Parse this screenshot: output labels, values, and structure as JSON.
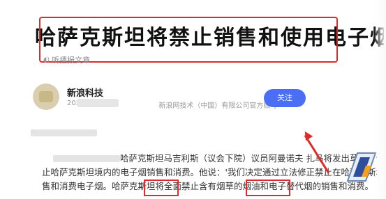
{
  "article": {
    "headline": "哈萨克斯坦将禁止销售和使用电子烟",
    "listen_label": "听播报文章"
  },
  "account": {
    "name": "新浪科技",
    "date": "2022-0",
    "source": "新浪网技术（中国）有限公司官方账号",
    "follow_label": "关注"
  },
  "body": {
    "lines": [
      "哈萨克斯坦马吉利斯（议会下院）议员阿曼诺夫 扎马将发出草案，计划禁",
      "止哈萨克斯坦境内的电子烟销售和消费。他说：'我们决定通过立法修正禁止在哈萨克斯坦销",
      "售和消费电子烟。哈萨克斯坦将全面禁止含有烟草的烟油和电子替代烟的销售和消费。"
    ]
  },
  "icons": {
    "listen": "speaker-icon",
    "arrow": "red-arrow-annotation",
    "watermark": "watermark-logo"
  },
  "colors": {
    "highlight": "#e02a2a",
    "follow": "#4a6ef5"
  }
}
